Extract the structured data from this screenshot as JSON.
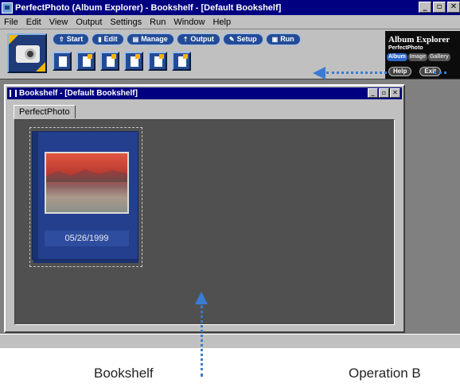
{
  "window": {
    "title": "PerfectPhoto (Album Explorer)  - Bookshelf - [Default Bookshelf]",
    "buttons": [
      "_",
      "▫",
      "✕"
    ]
  },
  "menu": [
    "File",
    "Edit",
    "View",
    "Output",
    "Settings",
    "Run",
    "Window",
    "Help"
  ],
  "modes": [
    {
      "label": "Start",
      "icon": "start-icon"
    },
    {
      "label": "Edit",
      "icon": "edit-icon"
    },
    {
      "label": "Manage",
      "icon": "manage-icon"
    },
    {
      "label": "Output",
      "icon": "output-icon"
    },
    {
      "label": "Setup",
      "icon": "setup-icon"
    },
    {
      "label": "Run",
      "icon": "run-icon"
    }
  ],
  "brand": {
    "name": "Album Explorer",
    "sub": "PerfectPhoto",
    "tabs": [
      "Album",
      "Image",
      "Gallery"
    ],
    "help": "Help",
    "exit": "Exit"
  },
  "child": {
    "title": "Bookshelf - [Default Bookshelf]",
    "tab": "PerfectPhoto",
    "album_date": "05/26/1999"
  },
  "captions": {
    "bookshelf": "Bookshelf",
    "operation": "Operation B"
  },
  "colors": {
    "titlebar": "#000080",
    "accent": "#3a7bd5",
    "toolbar_button": "#244c96"
  }
}
